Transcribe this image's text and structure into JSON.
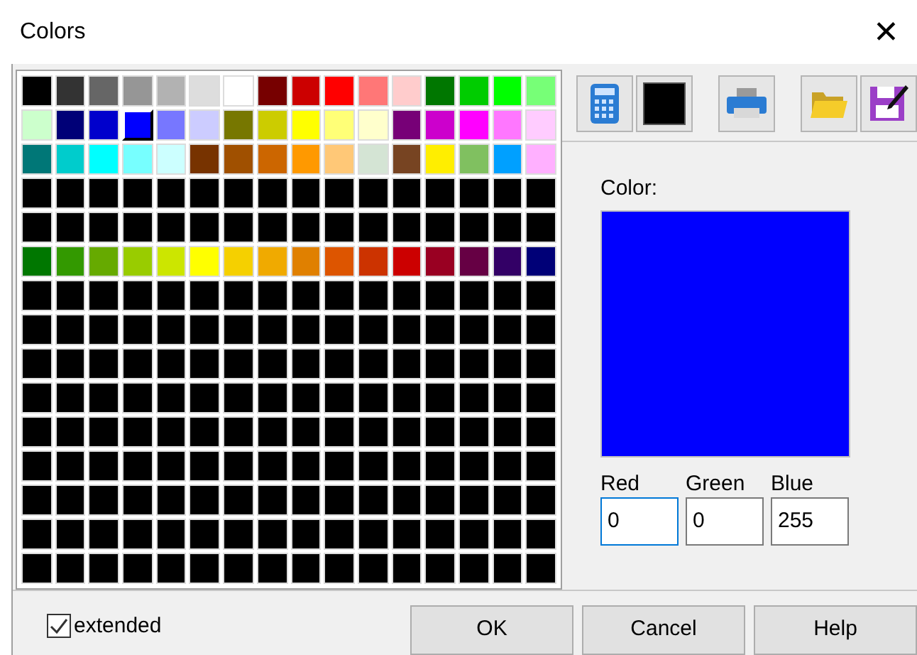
{
  "window": {
    "title": "Colors",
    "close": "✕"
  },
  "palette": {
    "rows": [
      [
        {
          "color": "#000000",
          "selected": false
        },
        {
          "color": "#333333",
          "selected": false
        },
        {
          "color": "#666666",
          "selected": false
        },
        {
          "color": "#969696",
          "selected": false
        },
        {
          "color": "#b2b2b2",
          "selected": false
        },
        {
          "color": "#dddddd",
          "selected": false
        },
        {
          "color": "#ffffff",
          "selected": false
        },
        {
          "color": "#770000",
          "selected": false
        },
        {
          "color": "#cc0000",
          "selected": false
        },
        {
          "color": "#ff0000",
          "selected": false
        },
        {
          "color": "#ff7777",
          "selected": false
        },
        {
          "color": "#ffcccc",
          "selected": false
        },
        {
          "color": "#007700",
          "selected": false
        },
        {
          "color": "#00cc00",
          "selected": false
        },
        {
          "color": "#00ff00",
          "selected": false
        },
        {
          "color": "#77ff77",
          "selected": false
        }
      ],
      [
        {
          "color": "#ccffcc",
          "selected": false
        },
        {
          "color": "#000077",
          "selected": false
        },
        {
          "color": "#0000cc",
          "selected": false
        },
        {
          "color": "#0000ff",
          "selected": true
        },
        {
          "color": "#7777ff",
          "selected": false
        },
        {
          "color": "#ccccff",
          "selected": false
        },
        {
          "color": "#777700",
          "selected": false
        },
        {
          "color": "#cccc00",
          "selected": false
        },
        {
          "color": "#ffff00",
          "selected": false
        },
        {
          "color": "#ffff77",
          "selected": false
        },
        {
          "color": "#ffffcc",
          "selected": false
        },
        {
          "color": "#770077",
          "selected": false
        },
        {
          "color": "#cc00cc",
          "selected": false
        },
        {
          "color": "#ff00ff",
          "selected": false
        },
        {
          "color": "#ff77ff",
          "selected": false
        },
        {
          "color": "#ffccff",
          "selected": false
        }
      ],
      [
        {
          "color": "#007777",
          "selected": false
        },
        {
          "color": "#00cccc",
          "selected": false
        },
        {
          "color": "#00ffff",
          "selected": false
        },
        {
          "color": "#77ffff",
          "selected": false
        },
        {
          "color": "#ccffff",
          "selected": false
        },
        {
          "color": "#773300",
          "selected": false
        },
        {
          "color": "#a05000",
          "selected": false
        },
        {
          "color": "#cc6600",
          "selected": false
        },
        {
          "color": "#ff9900",
          "selected": false
        },
        {
          "color": "#ffc877",
          "selected": false
        },
        {
          "color": "#d4e4d4",
          "selected": false
        },
        {
          "color": "#774422",
          "selected": false
        },
        {
          "color": "#ffee00",
          "selected": false
        },
        {
          "color": "#80c060",
          "selected": false
        },
        {
          "color": "#00a0ff",
          "selected": false
        },
        {
          "color": "#ffb0ff",
          "selected": false
        }
      ],
      [
        {
          "color": "#000000",
          "selected": false
        },
        {
          "color": "#000000",
          "selected": false
        },
        {
          "color": "#000000",
          "selected": false
        },
        {
          "color": "#000000",
          "selected": false
        },
        {
          "color": "#000000",
          "selected": false
        },
        {
          "color": "#000000",
          "selected": false
        },
        {
          "color": "#000000",
          "selected": false
        },
        {
          "color": "#000000",
          "selected": false
        },
        {
          "color": "#000000",
          "selected": false
        },
        {
          "color": "#000000",
          "selected": false
        },
        {
          "color": "#000000",
          "selected": false
        },
        {
          "color": "#000000",
          "selected": false
        },
        {
          "color": "#000000",
          "selected": false
        },
        {
          "color": "#000000",
          "selected": false
        },
        {
          "color": "#000000",
          "selected": false
        },
        {
          "color": "#000000",
          "selected": false
        }
      ],
      [
        {
          "color": "#000000",
          "selected": false
        },
        {
          "color": "#000000",
          "selected": false
        },
        {
          "color": "#000000",
          "selected": false
        },
        {
          "color": "#000000",
          "selected": false
        },
        {
          "color": "#000000",
          "selected": false
        },
        {
          "color": "#000000",
          "selected": false
        },
        {
          "color": "#000000",
          "selected": false
        },
        {
          "color": "#000000",
          "selected": false
        },
        {
          "color": "#000000",
          "selected": false
        },
        {
          "color": "#000000",
          "selected": false
        },
        {
          "color": "#000000",
          "selected": false
        },
        {
          "color": "#000000",
          "selected": false
        },
        {
          "color": "#000000",
          "selected": false
        },
        {
          "color": "#000000",
          "selected": false
        },
        {
          "color": "#000000",
          "selected": false
        },
        {
          "color": "#000000",
          "selected": false
        }
      ],
      [
        {
          "color": "#007700",
          "selected": false
        },
        {
          "color": "#339900",
          "selected": false
        },
        {
          "color": "#66aa00",
          "selected": false
        },
        {
          "color": "#99cc00",
          "selected": false
        },
        {
          "color": "#cce600",
          "selected": false
        },
        {
          "color": "#ffff00",
          "selected": false
        },
        {
          "color": "#f5d000",
          "selected": false
        },
        {
          "color": "#f0aa00",
          "selected": false
        },
        {
          "color": "#e08000",
          "selected": false
        },
        {
          "color": "#dd5500",
          "selected": false
        },
        {
          "color": "#cc3300",
          "selected": false
        },
        {
          "color": "#cc0000",
          "selected": false
        },
        {
          "color": "#990022",
          "selected": false
        },
        {
          "color": "#660044",
          "selected": false
        },
        {
          "color": "#330066",
          "selected": false
        },
        {
          "color": "#000077",
          "selected": false
        }
      ],
      [
        {
          "color": "#000000",
          "selected": false
        },
        {
          "color": "#000000",
          "selected": false
        },
        {
          "color": "#000000",
          "selected": false
        },
        {
          "color": "#000000",
          "selected": false
        },
        {
          "color": "#000000",
          "selected": false
        },
        {
          "color": "#000000",
          "selected": false
        },
        {
          "color": "#000000",
          "selected": false
        },
        {
          "color": "#000000",
          "selected": false
        },
        {
          "color": "#000000",
          "selected": false
        },
        {
          "color": "#000000",
          "selected": false
        },
        {
          "color": "#000000",
          "selected": false
        },
        {
          "color": "#000000",
          "selected": false
        },
        {
          "color": "#000000",
          "selected": false
        },
        {
          "color": "#000000",
          "selected": false
        },
        {
          "color": "#000000",
          "selected": false
        },
        {
          "color": "#000000",
          "selected": false
        }
      ],
      [
        {
          "color": "#000000",
          "selected": false
        },
        {
          "color": "#000000",
          "selected": false
        },
        {
          "color": "#000000",
          "selected": false
        },
        {
          "color": "#000000",
          "selected": false
        },
        {
          "color": "#000000",
          "selected": false
        },
        {
          "color": "#000000",
          "selected": false
        },
        {
          "color": "#000000",
          "selected": false
        },
        {
          "color": "#000000",
          "selected": false
        },
        {
          "color": "#000000",
          "selected": false
        },
        {
          "color": "#000000",
          "selected": false
        },
        {
          "color": "#000000",
          "selected": false
        },
        {
          "color": "#000000",
          "selected": false
        },
        {
          "color": "#000000",
          "selected": false
        },
        {
          "color": "#000000",
          "selected": false
        },
        {
          "color": "#000000",
          "selected": false
        },
        {
          "color": "#000000",
          "selected": false
        }
      ],
      [
        {
          "color": "#000000",
          "selected": false
        },
        {
          "color": "#000000",
          "selected": false
        },
        {
          "color": "#000000",
          "selected": false
        },
        {
          "color": "#000000",
          "selected": false
        },
        {
          "color": "#000000",
          "selected": false
        },
        {
          "color": "#000000",
          "selected": false
        },
        {
          "color": "#000000",
          "selected": false
        },
        {
          "color": "#000000",
          "selected": false
        },
        {
          "color": "#000000",
          "selected": false
        },
        {
          "color": "#000000",
          "selected": false
        },
        {
          "color": "#000000",
          "selected": false
        },
        {
          "color": "#000000",
          "selected": false
        },
        {
          "color": "#000000",
          "selected": false
        },
        {
          "color": "#000000",
          "selected": false
        },
        {
          "color": "#000000",
          "selected": false
        },
        {
          "color": "#000000",
          "selected": false
        }
      ],
      [
        {
          "color": "#000000",
          "selected": false
        },
        {
          "color": "#000000",
          "selected": false
        },
        {
          "color": "#000000",
          "selected": false
        },
        {
          "color": "#000000",
          "selected": false
        },
        {
          "color": "#000000",
          "selected": false
        },
        {
          "color": "#000000",
          "selected": false
        },
        {
          "color": "#000000",
          "selected": false
        },
        {
          "color": "#000000",
          "selected": false
        },
        {
          "color": "#000000",
          "selected": false
        },
        {
          "color": "#000000",
          "selected": false
        },
        {
          "color": "#000000",
          "selected": false
        },
        {
          "color": "#000000",
          "selected": false
        },
        {
          "color": "#000000",
          "selected": false
        },
        {
          "color": "#000000",
          "selected": false
        },
        {
          "color": "#000000",
          "selected": false
        },
        {
          "color": "#000000",
          "selected": false
        }
      ],
      [
        {
          "color": "#000000",
          "selected": false
        },
        {
          "color": "#000000",
          "selected": false
        },
        {
          "color": "#000000",
          "selected": false
        },
        {
          "color": "#000000",
          "selected": false
        },
        {
          "color": "#000000",
          "selected": false
        },
        {
          "color": "#000000",
          "selected": false
        },
        {
          "color": "#000000",
          "selected": false
        },
        {
          "color": "#000000",
          "selected": false
        },
        {
          "color": "#000000",
          "selected": false
        },
        {
          "color": "#000000",
          "selected": false
        },
        {
          "color": "#000000",
          "selected": false
        },
        {
          "color": "#000000",
          "selected": false
        },
        {
          "color": "#000000",
          "selected": false
        },
        {
          "color": "#000000",
          "selected": false
        },
        {
          "color": "#000000",
          "selected": false
        },
        {
          "color": "#000000",
          "selected": false
        }
      ],
      [
        {
          "color": "#000000",
          "selected": false
        },
        {
          "color": "#000000",
          "selected": false
        },
        {
          "color": "#000000",
          "selected": false
        },
        {
          "color": "#000000",
          "selected": false
        },
        {
          "color": "#000000",
          "selected": false
        },
        {
          "color": "#000000",
          "selected": false
        },
        {
          "color": "#000000",
          "selected": false
        },
        {
          "color": "#000000",
          "selected": false
        },
        {
          "color": "#000000",
          "selected": false
        },
        {
          "color": "#000000",
          "selected": false
        },
        {
          "color": "#000000",
          "selected": false
        },
        {
          "color": "#000000",
          "selected": false
        },
        {
          "color": "#000000",
          "selected": false
        },
        {
          "color": "#000000",
          "selected": false
        },
        {
          "color": "#000000",
          "selected": false
        },
        {
          "color": "#000000",
          "selected": false
        }
      ],
      [
        {
          "color": "#000000",
          "selected": false
        },
        {
          "color": "#000000",
          "selected": false
        },
        {
          "color": "#000000",
          "selected": false
        },
        {
          "color": "#000000",
          "selected": false
        },
        {
          "color": "#000000",
          "selected": false
        },
        {
          "color": "#000000",
          "selected": false
        },
        {
          "color": "#000000",
          "selected": false
        },
        {
          "color": "#000000",
          "selected": false
        },
        {
          "color": "#000000",
          "selected": false
        },
        {
          "color": "#000000",
          "selected": false
        },
        {
          "color": "#000000",
          "selected": false
        },
        {
          "color": "#000000",
          "selected": false
        },
        {
          "color": "#000000",
          "selected": false
        },
        {
          "color": "#000000",
          "selected": false
        },
        {
          "color": "#000000",
          "selected": false
        },
        {
          "color": "#000000",
          "selected": false
        }
      ],
      [
        {
          "color": "#000000",
          "selected": false
        },
        {
          "color": "#000000",
          "selected": false
        },
        {
          "color": "#000000",
          "selected": false
        },
        {
          "color": "#000000",
          "selected": false
        },
        {
          "color": "#000000",
          "selected": false
        },
        {
          "color": "#000000",
          "selected": false
        },
        {
          "color": "#000000",
          "selected": false
        },
        {
          "color": "#000000",
          "selected": false
        },
        {
          "color": "#000000",
          "selected": false
        },
        {
          "color": "#000000",
          "selected": false
        },
        {
          "color": "#000000",
          "selected": false
        },
        {
          "color": "#000000",
          "selected": false
        },
        {
          "color": "#000000",
          "selected": false
        },
        {
          "color": "#000000",
          "selected": false
        },
        {
          "color": "#000000",
          "selected": false
        },
        {
          "color": "#000000",
          "selected": false
        }
      ],
      [
        {
          "color": "#000000",
          "selected": false
        },
        {
          "color": "#000000",
          "selected": false
        },
        {
          "color": "#000000",
          "selected": false
        },
        {
          "color": "#000000",
          "selected": false
        },
        {
          "color": "#000000",
          "selected": false
        },
        {
          "color": "#000000",
          "selected": false
        },
        {
          "color": "#000000",
          "selected": false
        },
        {
          "color": "#000000",
          "selected": false
        },
        {
          "color": "#000000",
          "selected": false
        },
        {
          "color": "#000000",
          "selected": false
        },
        {
          "color": "#000000",
          "selected": false
        },
        {
          "color": "#000000",
          "selected": false
        },
        {
          "color": "#000000",
          "selected": false
        },
        {
          "color": "#000000",
          "selected": false
        },
        {
          "color": "#000000",
          "selected": false
        },
        {
          "color": "#000000",
          "selected": false
        }
      ]
    ]
  },
  "toolbar": {
    "swatch_button": {
      "color": "#000000"
    }
  },
  "preview": {
    "label": "Color:",
    "color": "#0000ff"
  },
  "fields": [
    {
      "label": "Red",
      "value": "0",
      "focused": true
    },
    {
      "label": "Green",
      "value": "0",
      "focused": false
    },
    {
      "label": "Blue",
      "value": "255",
      "focused": false
    }
  ],
  "extended": {
    "label": "extended",
    "checked": true
  },
  "buttons": [
    "OK",
    "Cancel",
    "Help"
  ]
}
